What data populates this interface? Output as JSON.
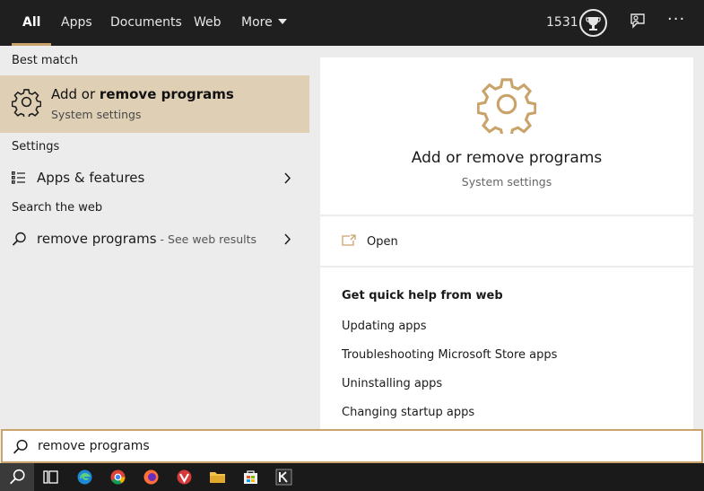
{
  "topbar": {
    "tabs": [
      {
        "label": "All",
        "active": true
      },
      {
        "label": "Apps"
      },
      {
        "label": "Documents"
      },
      {
        "label": "Web"
      },
      {
        "label": "More"
      }
    ],
    "points": "1531",
    "icons": [
      "trophy-icon",
      "feedback-icon",
      "more-options-icon"
    ]
  },
  "left": {
    "best_match_heading": "Best match",
    "best_match": {
      "title_prefix": "Add or ",
      "title_bold": "remove programs",
      "subtitle": "System settings",
      "icon": "gear-icon"
    },
    "settings_heading": "Settings",
    "settings_item": {
      "label": "Apps & features",
      "icon": "list-icon"
    },
    "web_heading": "Search the web",
    "web_item": {
      "label": "remove programs",
      "hint": " - See web results",
      "icon": "search-icon"
    }
  },
  "right": {
    "title": "Add or remove programs",
    "subtitle": "System settings",
    "open_label": "Open",
    "help_heading": "Get quick help from web",
    "help_links": [
      "Updating apps",
      "Troubleshooting Microsoft Store apps",
      "Uninstalling apps",
      "Changing startup apps"
    ]
  },
  "search": {
    "value": "remove programs"
  },
  "taskbar": {
    "icons": [
      "search-icon",
      "task-view-icon",
      "edge-icon",
      "chrome-icon",
      "firefox-icon",
      "vivaldi-icon",
      "file-explorer-icon",
      "store-icon",
      "app-k-icon"
    ]
  },
  "colors": {
    "accent": "#c9a36a",
    "highlight": "#dfcfb4",
    "dark": "#1f1f1f"
  }
}
